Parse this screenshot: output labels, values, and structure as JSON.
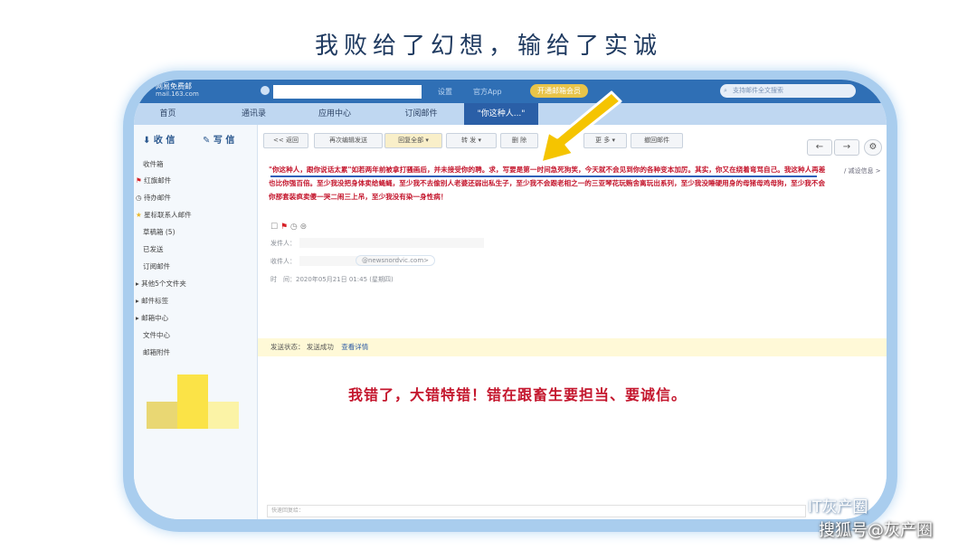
{
  "caption": "我败给了幻想，输给了实诚",
  "topbar": {
    "logo_line1": "网易免费邮",
    "logo_line2": "mail.163.com",
    "link1": "设置",
    "link2": "官方App",
    "promo": "开通邮箱会员",
    "search_placeholder": "支持邮件全文搜索"
  },
  "tabs": [
    {
      "label": "首页"
    },
    {
      "label": "通讯录"
    },
    {
      "label": "应用中心"
    },
    {
      "label": "订阅邮件"
    },
    {
      "label": "\"你这种人...\""
    }
  ],
  "sidebar": {
    "receive": "收 信",
    "write": "写 信",
    "folders": [
      "收件箱",
      "红旗邮件",
      "待办邮件",
      "星标联系人邮件",
      "草稿箱 (5)",
      "已发送",
      "订阅邮件",
      "其他5个文件夹",
      "邮件标签",
      "邮箱中心",
      "文件中心",
      "邮箱附件"
    ]
  },
  "toolbar": {
    "back": "<< 返回",
    "resend": "再次编辑发送",
    "reply_all": "回复全部",
    "forward": "转 发",
    "delete": "删 除",
    "more": "更 多",
    "print": "撤回邮件"
  },
  "email": {
    "subject": "\"你这种人，跟你说话太累\"如若两年前被拿打骚画后，并未接受你的聘。求，写要是第一时间急死狗笑，今天就不会见到你的各种变本加厉。其实，你又在绕着弯骂自己。我这种人再差也比你强百倍。至少我没把身体卖给蝇蝇，至少我不去偷别人老婆还弱出私生子，至少我不会跟老相之一的三亚琴花玩贿舍离玩出系列，至少我没睡硬用身的母猪母鸡母狗，至少我不会你那套装疯卖傻一哭二闹三上吊，至少我没有染一身性病！",
    "side_tip": "/ 减设信息 >",
    "from_label": "发件人：",
    "to_label": "收件人：",
    "to_addr": "@newsnordvic.com>",
    "time_label": "时　间：2020年05月21日 01:45 (星期四)",
    "status_label": "发送状态：",
    "status_value": "发送成功",
    "status_link": "查看详情",
    "body": "我错了，大错特错！错在跟畜生要担当、要诚信。",
    "reply_placeholder": "快速回复给："
  },
  "watermark": {
    "line1": "IT灰产圈",
    "line2": "搜狐号@灰产圈"
  }
}
